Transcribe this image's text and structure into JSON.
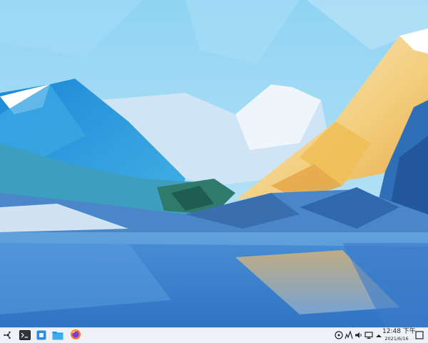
{
  "desktop": {
    "wallpaper_colors": {
      "sky": "#8fd0f2",
      "mountain_blue": "#2a8fd8",
      "peak_snow": "#ffffff",
      "sunlit_slope": "#f2c46a",
      "water": "#3b7fc9"
    }
  },
  "taskbar": {
    "launcher_icon": "application-launcher-icon",
    "apps": [
      {
        "name": "terminal-icon"
      },
      {
        "name": "discover-icon"
      },
      {
        "name": "file-manager-icon"
      },
      {
        "name": "firefox-icon"
      }
    ],
    "tray": {
      "icons": [
        "updates-icon",
        "network-icon",
        "volume-icon",
        "display-icon",
        "expand-tray-icon"
      ],
      "time": "12:48 下午",
      "date": "2021/6/16"
    },
    "show_desktop_icon": "show-desktop-icon"
  }
}
